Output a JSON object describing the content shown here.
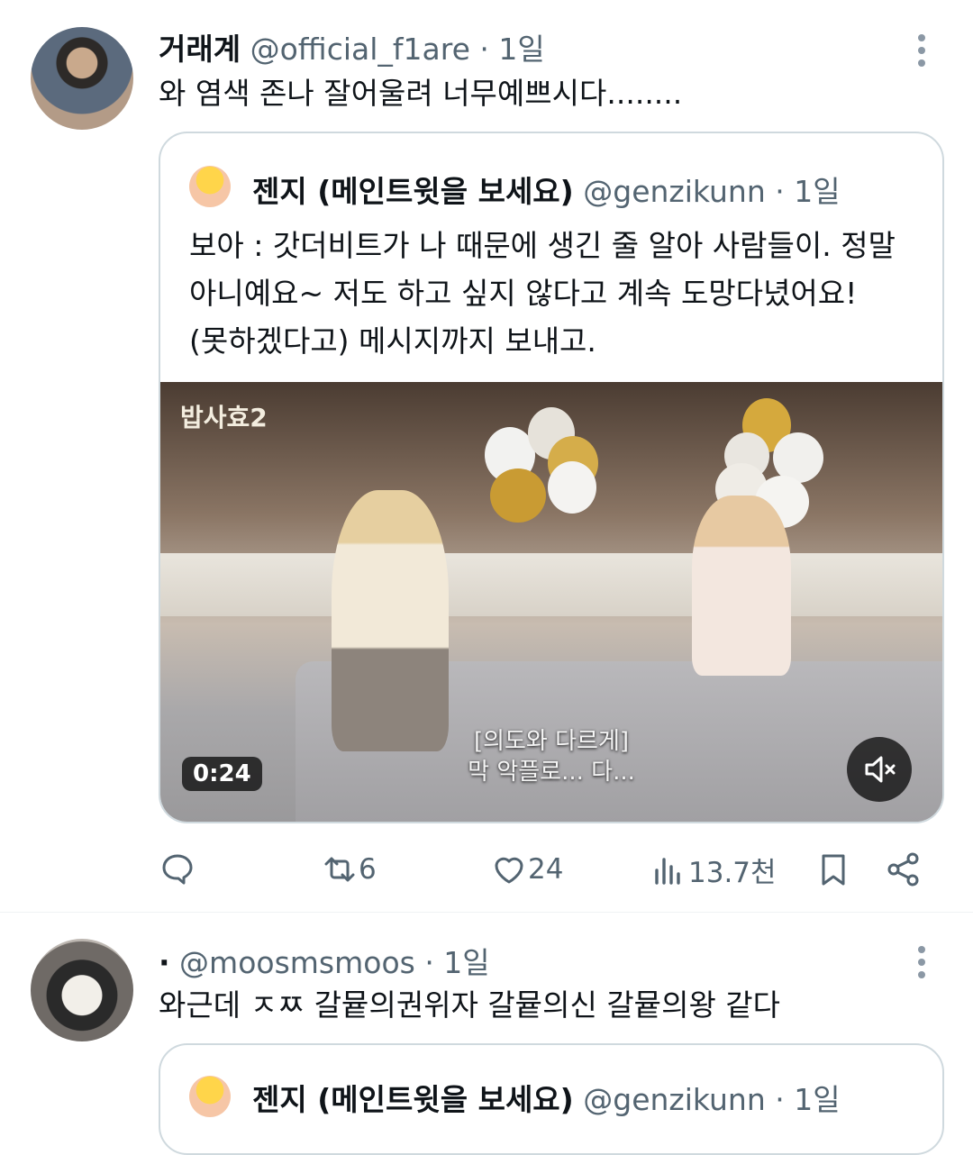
{
  "tweet1": {
    "name": "거래계",
    "handle": "@official_f1are",
    "time": "· 1일",
    "text": "와 염색 존나 잘어울려 너무예쁘시다........",
    "quote": {
      "name": "젠지 (메인트윗을 보세요)",
      "handle": "@genzikunn",
      "time": "· 1일",
      "lines": [
        "보아 : 갓더비트가 나 때문에 생긴 줄 알아 사람들이. 정말",
        "아니예요~ 저도 하고 싶지 않다고 계속 도망다녔어요!",
        "(못하겠다고) 메시지까지 보내고."
      ],
      "video": {
        "logo": "밥사효2",
        "duration": "0:24",
        "subtitle_line1": "[의도와 다르게]",
        "subtitle_line2": "막 악플로... 다..."
      }
    },
    "actions": {
      "reply_count": "",
      "retweet_count": "6",
      "like_count": "24",
      "views_count": "13.7천"
    }
  },
  "tweet2": {
    "name": "·",
    "handle": "@moosmsmoos",
    "time": "· 1일",
    "text": "와근데 ㅈㅉ 갈뮽의권위자 갈뮽의신 갈뮽의왕 같다",
    "quote": {
      "name": "젠지 (메인트윗을 보세요)",
      "handle": "@genzikunn",
      "time": "· 1일"
    }
  },
  "icons": {
    "reply": "reply-icon",
    "retweet": "retweet-icon",
    "like": "heart-icon",
    "views": "views-icon",
    "bookmark": "bookmark-icon",
    "share": "share-icon",
    "more": "more-icon",
    "mute": "mute-icon"
  },
  "colors": {
    "muted_text": "#536471",
    "border": "#cfd9de",
    "text": "#0f1419"
  }
}
